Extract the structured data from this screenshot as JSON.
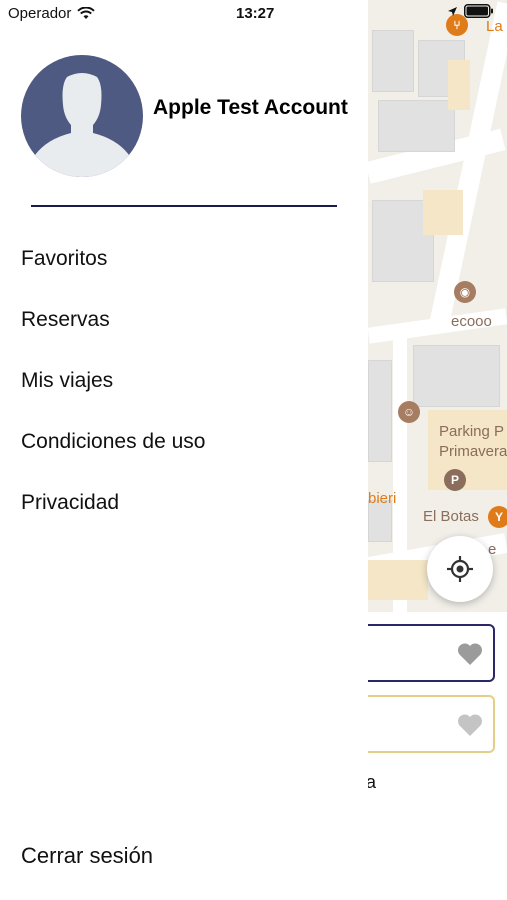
{
  "status_bar": {
    "carrier": "Operador",
    "time": "13:27"
  },
  "drawer": {
    "user_name": "Apple Test Account",
    "menu_items": [
      {
        "label": "Favoritos"
      },
      {
        "label": "Reservas"
      },
      {
        "label": "Mis viajes"
      },
      {
        "label": "Condiciones de uso"
      },
      {
        "label": "Privacidad"
      }
    ],
    "logout_label": "Cerrar sesión"
  },
  "map": {
    "poi_labels": {
      "top": "La",
      "ecooo": "ecooo",
      "parking_line1": "Parking P",
      "parking_line2": "Primavera",
      "bieri": "bieri",
      "el_botas": "El Botas",
      "partial": "e"
    },
    "parking_symbol": "P"
  },
  "background_peek_text": "a",
  "colors": {
    "accent_dark": "#1c1a4a",
    "card_border_selected": "#2a2766",
    "card_border_gold": "#e5cf87",
    "avatar_bg": "#4f5a82",
    "poi_orange": "#e07b1a"
  }
}
